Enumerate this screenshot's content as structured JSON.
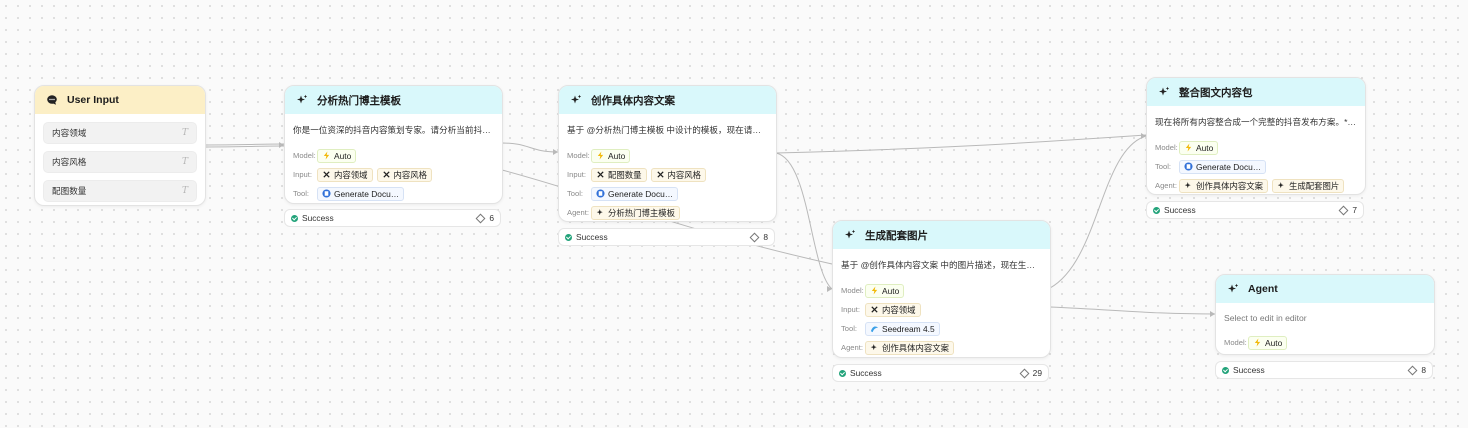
{
  "labels": {
    "model": "Model:",
    "input": "Input:",
    "tool": "Tool:",
    "agent": "Agent:"
  },
  "user_input": {
    "title": "User Input",
    "fields": [
      {
        "label": "内容领域",
        "type_glyph": "T"
      },
      {
        "label": "内容风格",
        "type_glyph": "T"
      },
      {
        "label": "配图数量",
        "type_glyph": "T"
      }
    ]
  },
  "nodes": {
    "analyze": {
      "title": "分析热门博主模板",
      "prompt": "你是一位资深的抖音内容策划专家。请分析当前抖音…",
      "model": "Auto",
      "inputs": [
        "内容领域",
        "内容风格"
      ],
      "tool": "Generate Docu…",
      "status": "Success",
      "count": "6"
    },
    "create": {
      "title": "创作具体内容文案",
      "prompt": "基于 @分析热门博主模板 中设计的模板，现在请创作…",
      "model": "Auto",
      "inputs": [
        "配图数量",
        "内容风格"
      ],
      "tool": "Generate Docu…",
      "agent": "分析热门博主模板",
      "status": "Success",
      "count": "8"
    },
    "image": {
      "title": "生成配套图片",
      "prompt": "基于 @创作具体内容文案 中的图片描述，现在生成所…",
      "model": "Auto",
      "inputs": [
        "内容领域"
      ],
      "tool": "Seedream 4.5",
      "agent": "创作具体内容文案",
      "status": "Success",
      "count": "29"
    },
    "integrate": {
      "title": "整合图文内容包",
      "prompt": "现在将所有内容整合成一个完整的抖音发布方案。**…",
      "model": "Auto",
      "tool": "Generate Docu…",
      "agents": [
        "创作具体内容文案",
        "生成配套图片"
      ],
      "status": "Success",
      "count": "7"
    },
    "agent": {
      "title": "Agent",
      "prompt": "Select to edit in editor",
      "model": "Auto",
      "status": "Success",
      "count": "8"
    }
  },
  "colors": {
    "agent_header": "#d9f8fb",
    "user_header": "#fcefc6",
    "success": "#22a37a",
    "edge": "#b9b9b9"
  },
  "icons": {
    "agent_header": "sparkle-icon",
    "user_header": "chat-bubble-icon",
    "model": "lightning-icon",
    "input": "variable-x-icon",
    "tool_doc": "document-tool-icon",
    "tool_image": "seedream-icon",
    "status": "check-circle-icon",
    "count": "diamond-icon"
  }
}
